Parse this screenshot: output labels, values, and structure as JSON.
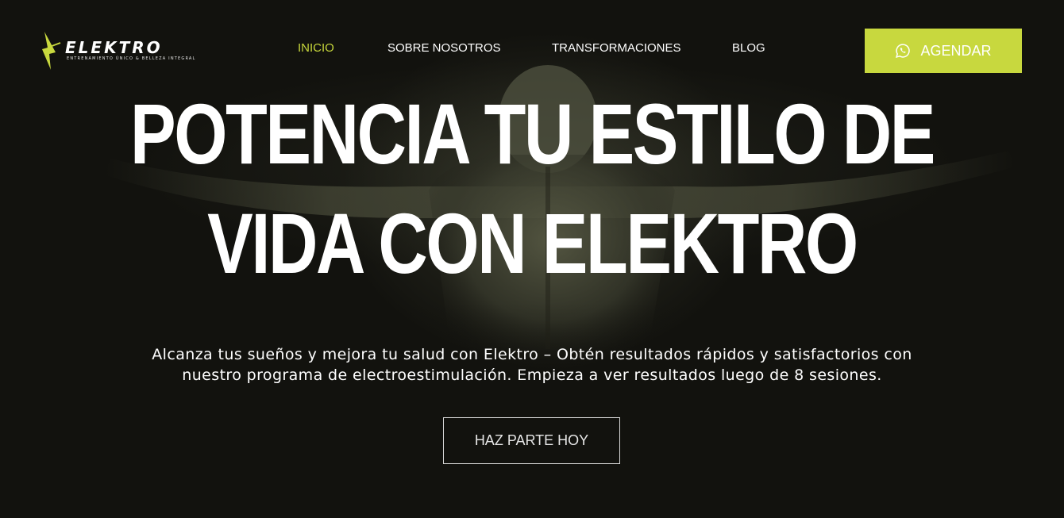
{
  "brand": {
    "name": "ELEKTRO",
    "tagline": "ENTRENAMIENTO ÚNICO & BELLEZA INTEGRAL",
    "accent_color": "#c8d83e"
  },
  "nav": {
    "items": [
      {
        "label": "INICIO",
        "active": true
      },
      {
        "label": "SOBRE NOSOTROS",
        "active": false
      },
      {
        "label": "TRANSFORMACIONES",
        "active": false
      },
      {
        "label": "BLOG",
        "active": false
      }
    ],
    "cta_label": "AGENDAR",
    "cta_icon": "whatsapp-icon"
  },
  "hero": {
    "headline_line1": "POTENCIA TU ESTILO DE",
    "headline_line2": "VIDA CON ELEKTRO",
    "subtext_line1": "Alcanza tus sueños y mejora tu salud con Elektro – Obtén resultados rápidos y satisfactorios con",
    "subtext_line2": "nuestro programa de electroestimulación. Empieza a ver resultados luego de 8 sesiones.",
    "button_label": "HAZ PARTE HOY"
  }
}
